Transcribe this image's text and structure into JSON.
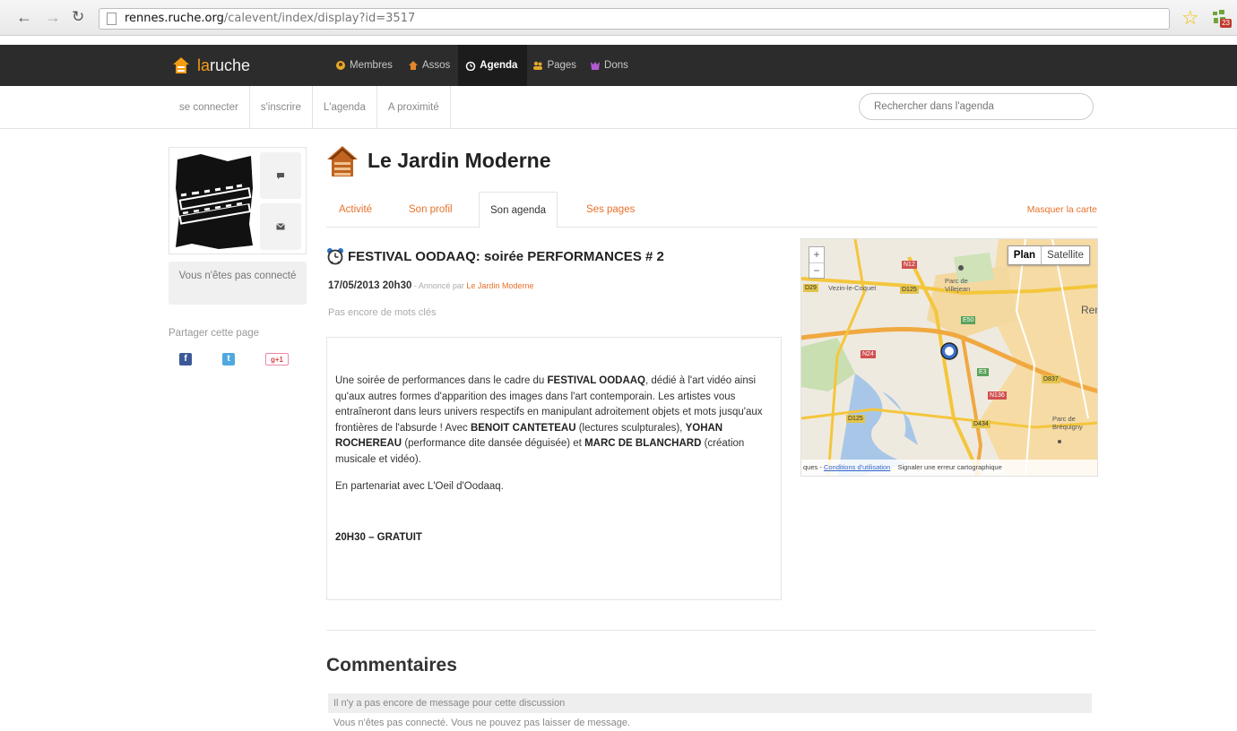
{
  "browser": {
    "url_host": "rennes.ruche.org",
    "url_path": "/calevent/index/display?id=3517",
    "extension_badge": "23"
  },
  "topbar": {
    "logo_prefix": "la",
    "logo_suffix": "ruche",
    "nav": [
      {
        "label": "Membres",
        "icon": "members-icon"
      },
      {
        "label": "Assos",
        "icon": "associations-icon"
      },
      {
        "label": "Agenda",
        "icon": "agenda-icon",
        "active": true
      },
      {
        "label": "Pages",
        "icon": "pages-icon"
      },
      {
        "label": "Dons",
        "icon": "donations-icon"
      }
    ]
  },
  "subnav": {
    "links": [
      "se connecter",
      "s'inscrire",
      "L'agenda",
      "A proximité"
    ],
    "search_placeholder": "Rechercher dans l'agenda"
  },
  "sidebar": {
    "not_connected": "Vous n'êtes pas connecté",
    "share_label": "Partager cette page",
    "share": [
      "f",
      "t",
      "g+1"
    ]
  },
  "org": {
    "name": "Le Jardin Moderne",
    "tabs": [
      "Activité",
      "Son profil",
      "Son agenda",
      "Ses pages"
    ],
    "active_tab": 2,
    "hide_map": "Masquer la carte"
  },
  "event": {
    "title": "FESTIVAL OODAAQ: soirée PERFORMANCES # 2",
    "date": "17/05/2013 20h30",
    "sep": " - ",
    "announced_by": "Annoncé par ",
    "organizer": "Le Jardin Moderne",
    "keywords": "Pas encore de mots clés",
    "description": {
      "t1": "Une soirée de performances dans le cadre du ",
      "b1": "FESTIVAL OODAAQ",
      "t2": ", dédié à l'art vidéo ainsi qu'aux autres formes d'apparition des images dans l'art contemporain. Les artistes vous entraîneront dans leurs univers respectifs en manipulant adroitement objets et mots jusqu'aux frontières de l'absurde ! Avec ",
      "b2": "BENOIT CANTETEAU",
      "t3": " (lectures sculpturales), ",
      "b3": "YOHAN ROCHEREAU",
      "t4": " (performance dite dansée déguisée) et ",
      "b4": "MARC DE BLANCHARD",
      "t5": " (création musicale et vidéo).",
      "partner": "En partenariat avec L'Oeil d'Oodaaq.",
      "price": "20H30 – GRATUIT"
    }
  },
  "map": {
    "zoom_in": "+",
    "zoom_out": "−",
    "type_plan": "Plan",
    "type_satellite": "Satellite",
    "labels": [
      "Vezin-le-Coquet",
      "Parc de Villejean",
      "Ren",
      "Parc de Bréquigny"
    ],
    "roads": [
      "N12",
      "D125",
      "D29",
      "N24",
      "E50",
      "E3",
      "N136",
      "D837",
      "D434",
      "D125"
    ],
    "footer_terms": "Conditions d'utilisation",
    "footer_report": "Signaler une erreur cartographique",
    "footer_prefix": "ques - "
  },
  "comments": {
    "title": "Commentaires",
    "empty": "Il n'y a pas encore de message pour cette discussion",
    "not_connected": "Vous n'êtes pas connecté. Vous ne pouvez pas laisser de message."
  }
}
